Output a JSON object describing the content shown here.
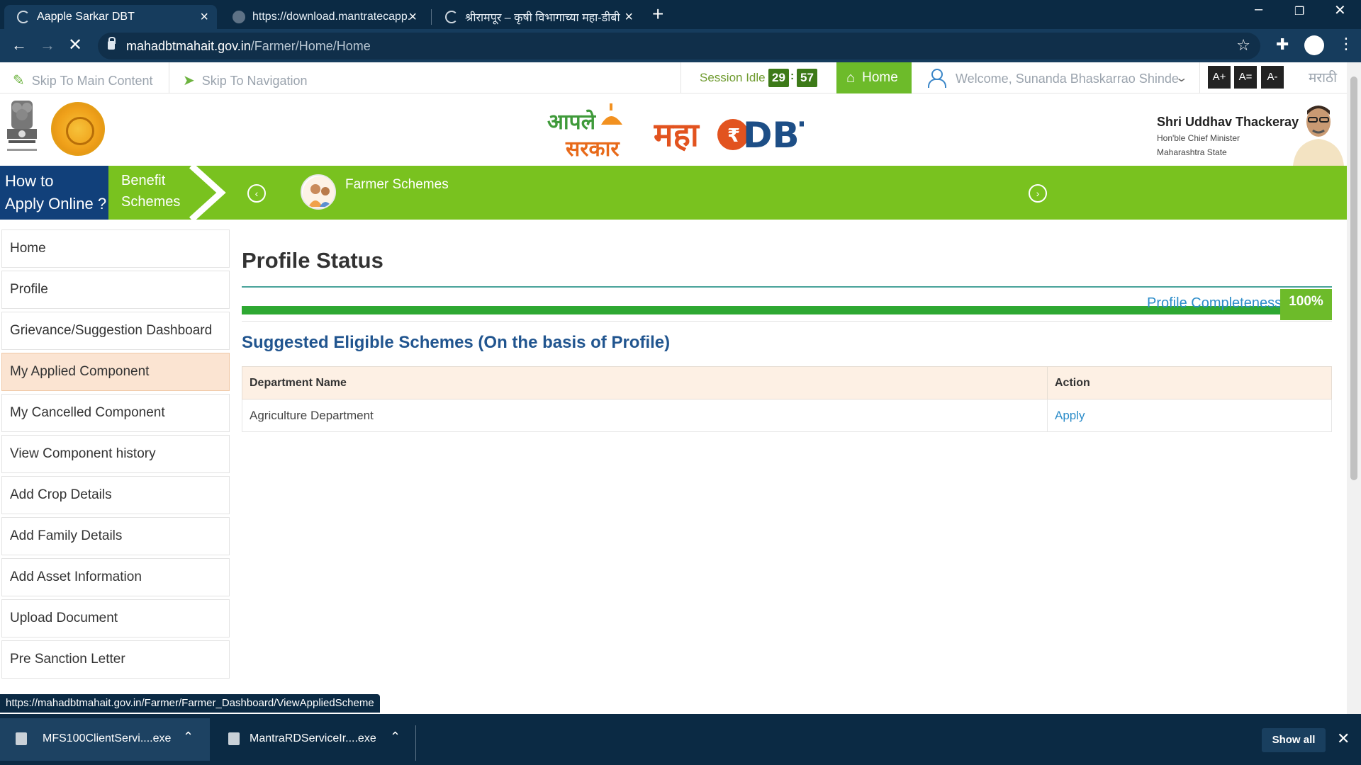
{
  "browser": {
    "tabs": [
      {
        "title": "Aapple Sarkar DBT",
        "active": true,
        "icon": "loading-spinner-icon"
      },
      {
        "title": "https://download.mantratecapp.",
        "active": false,
        "icon": "globe-icon"
      },
      {
        "title": "श्रीरामपूर – कृषी विभागाच्या महा-डीबी",
        "active": false,
        "icon": "loading-spinner-icon"
      }
    ],
    "new_tab_label": "+",
    "url_domain": "mahadbtmahait.gov.in",
    "url_path": "/Farmer/Home/Home",
    "status_url": "https://mahadbtmahait.gov.in/Farmer/Farmer_Dashboard/ViewAppliedScheme"
  },
  "utility_bar": {
    "skip_main": "Skip To Main Content",
    "skip_nav": "Skip To Navigation",
    "session_label": "Session Idle",
    "session_minutes": "29",
    "session_seconds": "57",
    "home_label": "Home",
    "welcome_text": "Welcome, Sunanda Bhaskarrao Shinde",
    "font_increase": "A+",
    "font_reset": "A=",
    "font_decrease": "A-",
    "language_link": "मराठी"
  },
  "header": {
    "logo_aaple_line1": "आपले",
    "logo_aaple_line2": "सरकार",
    "logo_maha": "महा",
    "logo_dbt": "DBT",
    "cm_name": "Shri Uddhav Thackeray",
    "cm_title": "Hon'ble Chief Minister",
    "cm_state": "Maharashtra State"
  },
  "banner": {
    "howto_line1": "How to",
    "howto_line2": "Apply Online ?",
    "benefit_line1": "Benefit",
    "benefit_line2": "Schemes",
    "scheme_label": "Farmer Schemes"
  },
  "sidebar": {
    "items": [
      {
        "label": "Home",
        "active": false
      },
      {
        "label": "Profile",
        "active": false
      },
      {
        "label": "Grievance/Suggestion Dashboard",
        "active": false
      },
      {
        "label": "My Applied Component",
        "active": true
      },
      {
        "label": "My Cancelled Component",
        "active": false
      },
      {
        "label": "View Component history",
        "active": false
      },
      {
        "label": "Add Crop Details",
        "active": false
      },
      {
        "label": "Add Family Details",
        "active": false
      },
      {
        "label": "Add Asset Information",
        "active": false
      },
      {
        "label": "Upload Document",
        "active": false
      },
      {
        "label": "Pre Sanction Letter",
        "active": false
      }
    ]
  },
  "main": {
    "title": "Profile Status",
    "completeness_label": "Profile Completeness",
    "completeness_value": "100%",
    "completeness_fraction": 1.0,
    "subheading": "Suggested Eligible Schemes (On the basis of Profile)",
    "table": {
      "headers": [
        "Department Name",
        "Action"
      ],
      "rows": [
        {
          "department": "Agriculture Department",
          "action": "Apply"
        }
      ]
    }
  },
  "downloads": {
    "items": [
      {
        "name": "MFS100ClientServi....exe"
      },
      {
        "name": "MantraRDServiceIr....exe"
      }
    ],
    "show_all": "Show all"
  },
  "colors": {
    "banner_green": "#79c21f",
    "howto_blue": "#11407a",
    "progress_green": "#2ea832",
    "link_blue": "#2b8cc9",
    "active_item_bg": "#fbe4d2"
  }
}
